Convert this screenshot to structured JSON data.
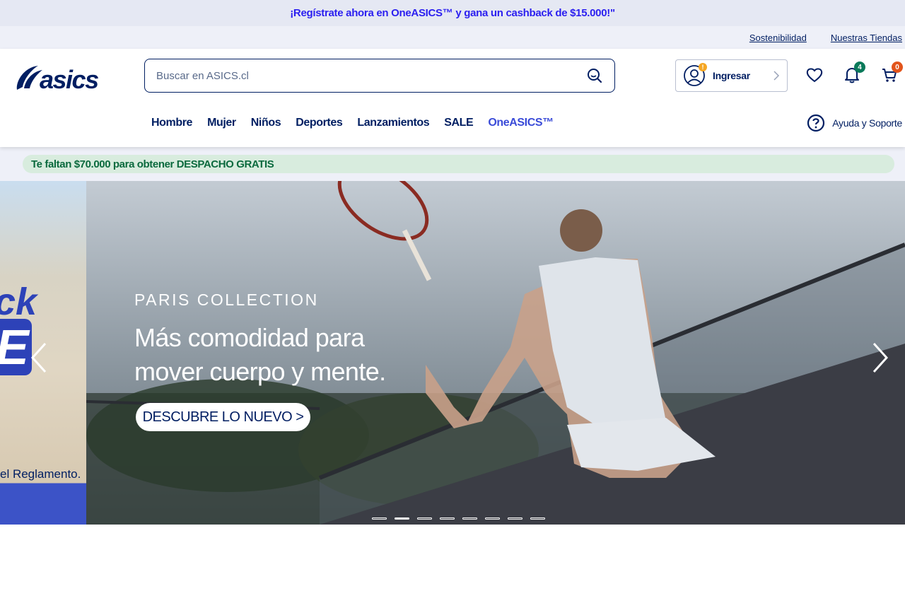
{
  "promo": {
    "text": "¡Regístrate ahora en OneASICS™ y gana un cashback de $15.000!\""
  },
  "utility": {
    "sustainability": "Sostenibilidad",
    "stores": "Nuestras Tiendas"
  },
  "brand": {
    "logo_text": "asics",
    "color": "#001e62"
  },
  "search": {
    "placeholder": "Buscar en ASICS.cl"
  },
  "account": {
    "login_label": "Ingresar",
    "alert": "!"
  },
  "icons": {
    "notifications_count": "4",
    "cart_count": "0",
    "notif_badge_color": "#0b7a5a",
    "cart_badge_color": "#e2541b"
  },
  "nav": {
    "items": [
      "Hombre",
      "Mujer",
      "Niños",
      "Deportes",
      "Lanzamientos",
      "SALE",
      "OneASICS™"
    ]
  },
  "help": {
    "label": "Ayuda y Soporte"
  },
  "shipping": {
    "text": "Te faltan $70.000 para obtener DESPACHO GRATIS"
  },
  "hero": {
    "prev_slide": {
      "line1": "ck",
      "line2": "E",
      "caption": "el Reglamento."
    },
    "eyebrow": "PARIS COLLECTION",
    "headline_1": "Más comodidad para",
    "headline_2": "mover cuerpo y mente.",
    "cta": "DESCUBRE LO NUEVO >",
    "slide_count": 8,
    "active_slide": 2
  }
}
